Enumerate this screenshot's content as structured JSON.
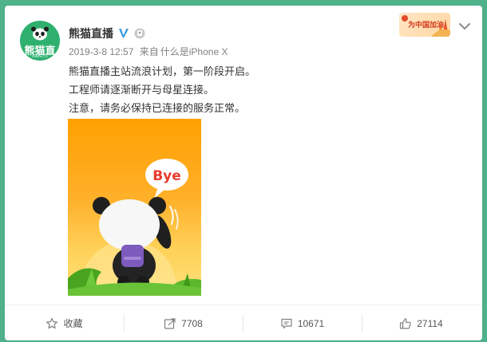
{
  "post": {
    "username": "熊猫直播",
    "avatar_text": "熊猫直播",
    "avatar_subtext": "PANDA.TV",
    "timestamp": "2019-3-8 12:57",
    "source_prefix": "来自",
    "source_device": "什么是iPhone X",
    "campaign_badge": "为中国加油",
    "lines": [
      "熊猫直播主站流浪计划，第一阶段开启。",
      "工程师请逐渐断开与母星连接。",
      "注意，请务必保持已连接的服务正常。"
    ],
    "image_bubble_text": "Bye"
  },
  "actions": {
    "favorite": {
      "label": "收藏"
    },
    "repost": {
      "count": "7708"
    },
    "comment": {
      "count": "10671"
    },
    "like": {
      "count": "27114"
    }
  },
  "colors": {
    "page_background": "#4fb28a",
    "avatar_green": "#2fb06f",
    "verified_blue": "#3b9ce2",
    "image_orange": "#ffa000",
    "bubble_red": "#e83b2a"
  },
  "icons": [
    "verified-icon",
    "badge-icon",
    "chevron-down-icon",
    "star-icon",
    "repost-icon",
    "comment-icon",
    "like-icon"
  ]
}
